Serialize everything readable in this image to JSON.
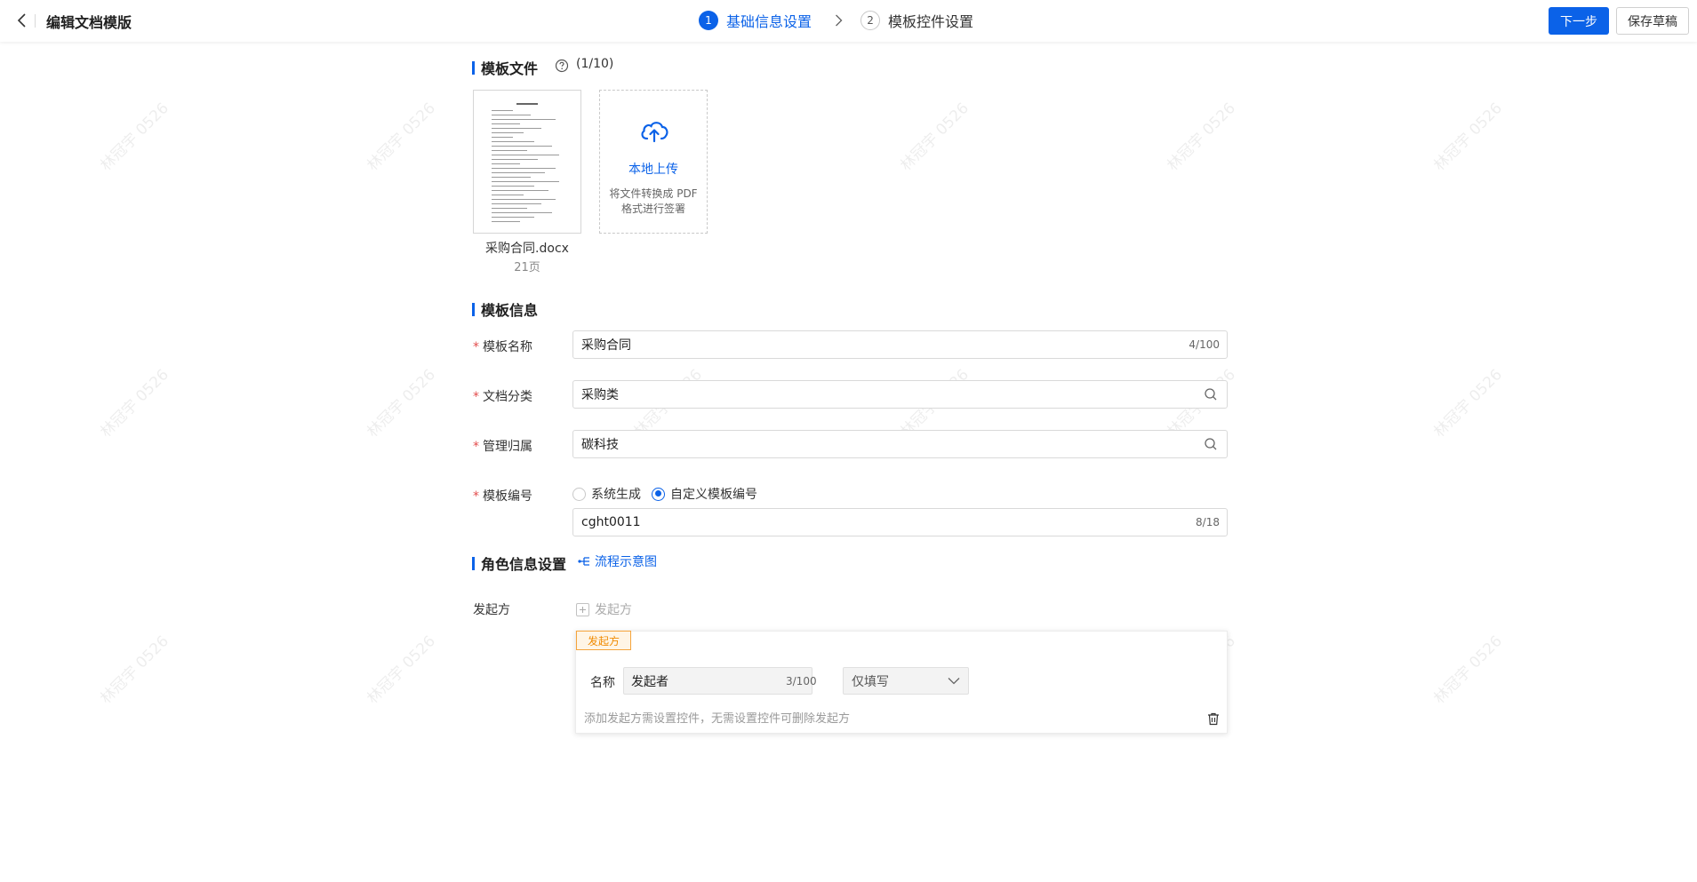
{
  "header": {
    "title": "编辑文档模版",
    "steps": [
      {
        "num": "1",
        "label": "基础信息设置"
      },
      {
        "num": "2",
        "label": "模板控件设置"
      }
    ],
    "next_label": "下一步",
    "save_draft_label": "保存草稿"
  },
  "watermark": "林冠宇 0526",
  "template_file": {
    "title": "模板文件",
    "count": "(1/10)",
    "file": {
      "name": "采购合同.docx",
      "pages": "21页"
    },
    "upload": {
      "label": "本地上传",
      "hint": "将文件转换成 PDF 格式进行签署"
    }
  },
  "template_info": {
    "title": "模板信息",
    "fields": {
      "name": {
        "label": "模板名称",
        "value": "采购合同",
        "count": "4/100"
      },
      "category": {
        "label": "文档分类",
        "value": "采购类"
      },
      "owner": {
        "label": "管理归属",
        "value": "碳科技"
      },
      "number": {
        "label": "模板编号",
        "options": [
          "系统生成",
          "自定义模板编号"
        ],
        "selected": "自定义模板编号",
        "value": "cght0011",
        "count": "8/18"
      }
    }
  },
  "roles": {
    "title": "角色信息设置",
    "flow_link": "流程示意图",
    "initiator_label": "发起方",
    "add_initiator": "发起方",
    "card": {
      "tag": "发起方",
      "name_label": "名称",
      "name_value": "发起者",
      "name_count": "3/100",
      "permission": "仅填写",
      "hint": "添加发起方需设置控件，无需设置控件可删除发起方"
    }
  },
  "colors": {
    "primary": "#0b62e8",
    "required": "#e34d4d",
    "tag_orange": "#f08a00"
  }
}
